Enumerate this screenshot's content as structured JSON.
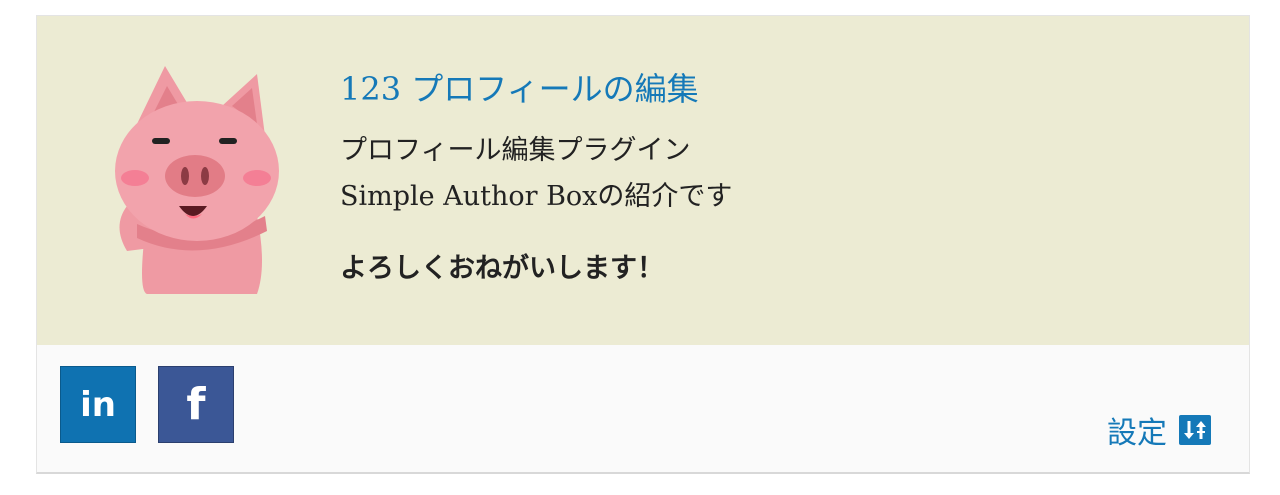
{
  "author": {
    "name": "123 プロフィールの編集",
    "description_line1": "プロフィール編集プラグイン",
    "description_line2": "Simple Author Boxの紹介です",
    "greeting": "よろしくおねがいします！"
  },
  "social": {
    "linkedin": {
      "label": "in",
      "icon": "linkedin-icon",
      "color": "#0f72b1"
    },
    "facebook": {
      "label": "f",
      "icon": "facebook-icon",
      "color": "#3b5796"
    }
  },
  "settings": {
    "label": "設定",
    "icon": "sliders-icon"
  },
  "colors": {
    "header_bg": "#ecebd3",
    "footer_bg": "#fafafa",
    "link": "#1579b8",
    "text": "#222222"
  }
}
